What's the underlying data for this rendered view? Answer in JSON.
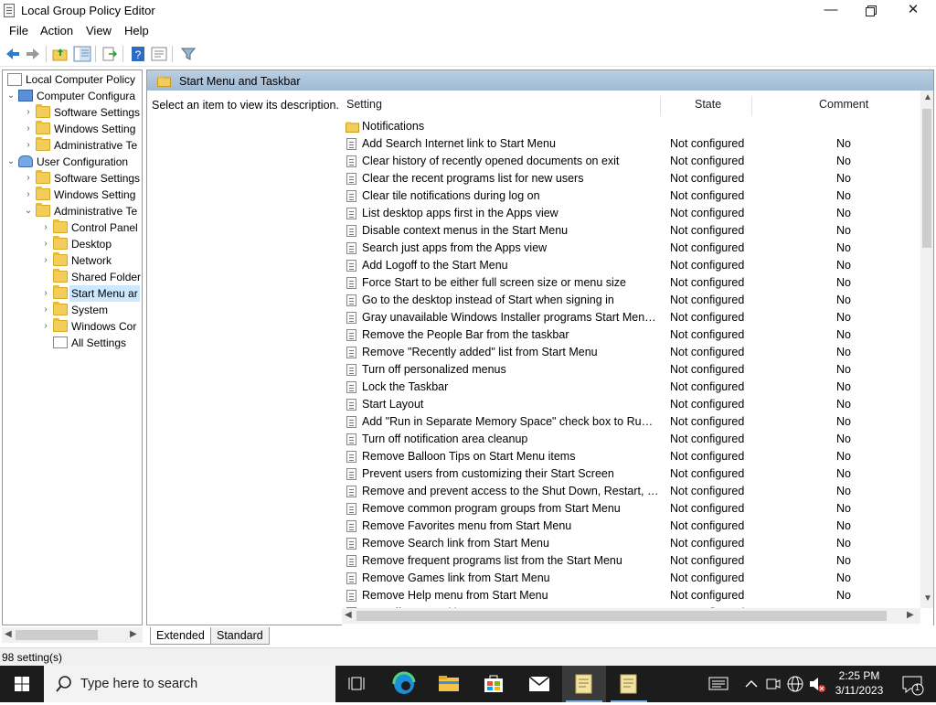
{
  "window": {
    "title": "Local Group Policy Editor"
  },
  "menu": [
    "File",
    "Action",
    "View",
    "Help"
  ],
  "toolbar": {
    "icons": [
      "back-icon",
      "forward-icon",
      "up-folder-icon",
      "show-hide-tree-icon",
      "export-list-icon",
      "help-icon",
      "properties-icon",
      "filter-icon"
    ]
  },
  "tree": {
    "root": "Local Computer Policy",
    "computer_config": "Computer Configura",
    "cc_software": "Software Settings",
    "cc_windows": "Windows Setting",
    "cc_admin": "Administrative Te",
    "user_config": "User Configuration",
    "uc_software": "Software Settings",
    "uc_windows": "Windows Setting",
    "uc_admin": "Administrative Te",
    "control_panel": "Control Panel",
    "desktop": "Desktop",
    "network": "Network",
    "shared_folders": "Shared Folder",
    "start_menu": "Start Menu ar",
    "system": "System",
    "windows_components": "Windows Cor",
    "all_settings": "All Settings"
  },
  "main": {
    "header_title": "Start Menu and Taskbar",
    "description": "Select an item to view its description.",
    "columns": {
      "setting": "Setting",
      "state": "State",
      "comment": "Comment"
    },
    "folder_row": "Notifications",
    "rows": [
      {
        "name": "Add Search Internet link to Start Menu",
        "state": "Not configured",
        "comment": "No"
      },
      {
        "name": "Clear history of recently opened documents on exit",
        "state": "Not configured",
        "comment": "No"
      },
      {
        "name": "Clear the recent programs list for new users",
        "state": "Not configured",
        "comment": "No"
      },
      {
        "name": "Clear tile notifications during log on",
        "state": "Not configured",
        "comment": "No"
      },
      {
        "name": "List desktop apps first in the Apps view",
        "state": "Not configured",
        "comment": "No"
      },
      {
        "name": "Disable context menus in the Start Menu",
        "state": "Not configured",
        "comment": "No"
      },
      {
        "name": "Search just apps from the Apps view",
        "state": "Not configured",
        "comment": "No"
      },
      {
        "name": "Add Logoff to the Start Menu",
        "state": "Not configured",
        "comment": "No"
      },
      {
        "name": "Force Start to be either full screen size or menu size",
        "state": "Not configured",
        "comment": "No"
      },
      {
        "name": "Go to the desktop instead of Start when signing in",
        "state": "Not configured",
        "comment": "No"
      },
      {
        "name": "Gray unavailable Windows Installer programs Start Menu sh...",
        "state": "Not configured",
        "comment": "No"
      },
      {
        "name": "Remove the People Bar from the taskbar",
        "state": "Not configured",
        "comment": "No"
      },
      {
        "name": "Remove \"Recently added\" list from Start Menu",
        "state": "Not configured",
        "comment": "No"
      },
      {
        "name": "Turn off personalized menus",
        "state": "Not configured",
        "comment": "No"
      },
      {
        "name": "Lock the Taskbar",
        "state": "Not configured",
        "comment": "No"
      },
      {
        "name": "Start Layout",
        "state": "Not configured",
        "comment": "No"
      },
      {
        "name": "Add \"Run in Separate Memory Space\" check box to Run dial...",
        "state": "Not configured",
        "comment": "No"
      },
      {
        "name": "Turn off notification area cleanup",
        "state": "Not configured",
        "comment": "No"
      },
      {
        "name": "Remove Balloon Tips on Start Menu items",
        "state": "Not configured",
        "comment": "No"
      },
      {
        "name": "Prevent users from customizing their Start Screen",
        "state": "Not configured",
        "comment": "No"
      },
      {
        "name": "Remove and prevent access to the Shut Down, Restart, Sleep...",
        "state": "Not configured",
        "comment": "No"
      },
      {
        "name": "Remove common program groups from Start Menu",
        "state": "Not configured",
        "comment": "No"
      },
      {
        "name": "Remove Favorites menu from Start Menu",
        "state": "Not configured",
        "comment": "No"
      },
      {
        "name": "Remove Search link from Start Menu",
        "state": "Not configured",
        "comment": "No"
      },
      {
        "name": "Remove frequent programs list from the Start Menu",
        "state": "Not configured",
        "comment": "No"
      },
      {
        "name": "Remove Games link from Start Menu",
        "state": "Not configured",
        "comment": "No"
      },
      {
        "name": "Remove Help menu from Start Menu",
        "state": "Not configured",
        "comment": "No"
      },
      {
        "name": "Turn off user tracking",
        "state": "Not configured",
        "comment": "No"
      }
    ]
  },
  "tabs": {
    "extended": "Extended",
    "standard": "Standard"
  },
  "status": "98 setting(s)",
  "taskbar": {
    "search_placeholder": "Type here to search",
    "time": "2:25 PM",
    "date": "3/11/2023",
    "notification_count": "1"
  }
}
